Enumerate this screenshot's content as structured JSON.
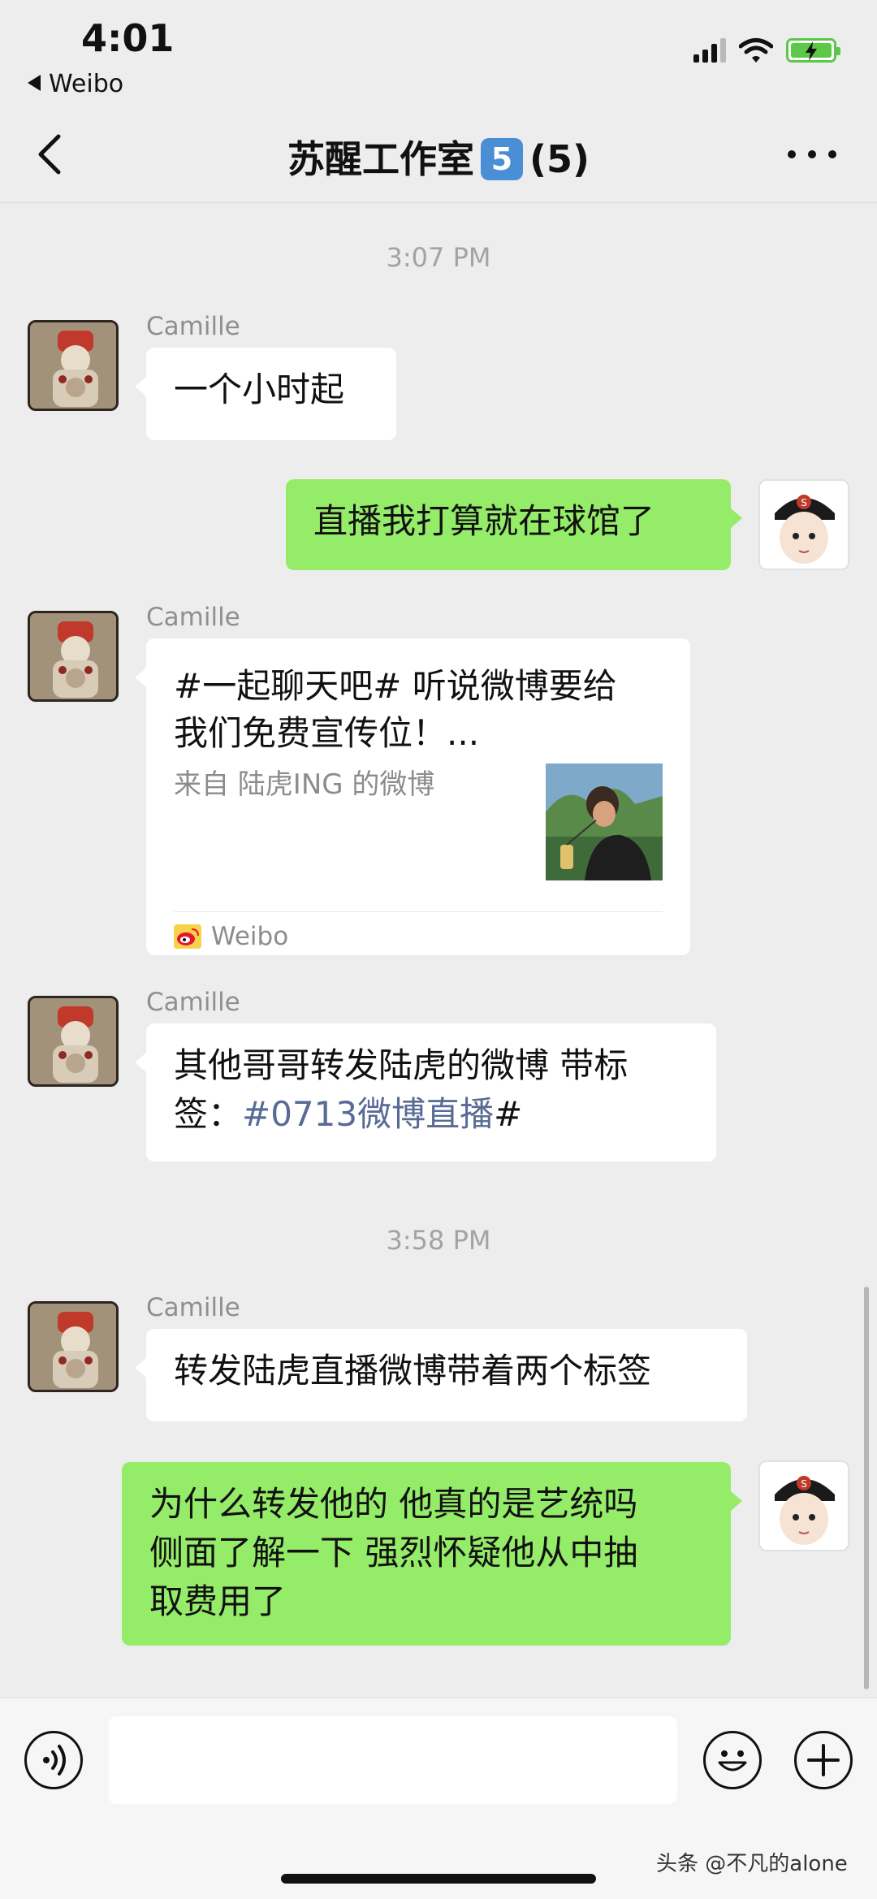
{
  "status_bar": {
    "time": "4:01",
    "back_app": "Weibo"
  },
  "nav": {
    "title": "苏醒工作室",
    "badge": "5",
    "member_count": "(5)"
  },
  "messages": {
    "ts1": "3:07 PM",
    "m1": {
      "sender": "Camille",
      "text": "一个小时起"
    },
    "m2": {
      "text": "直播我打算就在球馆了"
    },
    "m3": {
      "sender": "Camille",
      "title_line1": "#一起聊天吧# 听说微博要给",
      "title_line2": "我们免费宣传位！...",
      "source": "来自 陆虎ING 的微博",
      "app": "Weibo"
    },
    "m4": {
      "sender": "Camille",
      "line1": "其他哥哥转发陆虎的微博 带标",
      "line2_prefix": "签：",
      "line2_link": "#0713微博直播",
      "line2_suffix": "#"
    },
    "ts2": "3:58 PM",
    "m5": {
      "sender": "Camille",
      "text": "转发陆虎直播微博带着两个标签"
    },
    "m6": {
      "line1": "为什么转发他的 他真的是艺统吗",
      "line2": "侧面了解一下 强烈怀疑他从中抽",
      "line3": "取费用了"
    }
  },
  "input": {
    "placeholder": ""
  },
  "watermark": "头条 @不凡的alone",
  "colors": {
    "background": "#ededed",
    "outgoing_bubble": "#95ec69",
    "incoming_bubble": "#ffffff",
    "link": "#576b95",
    "badge": "#4a8fd6",
    "battery": "#5cc84a"
  },
  "icons": [
    "back-arrow-icon",
    "signal-icon",
    "wifi-icon",
    "battery-icon",
    "more-icon",
    "voice-icon",
    "emoji-icon",
    "plus-icon",
    "weibo-logo-icon"
  ]
}
